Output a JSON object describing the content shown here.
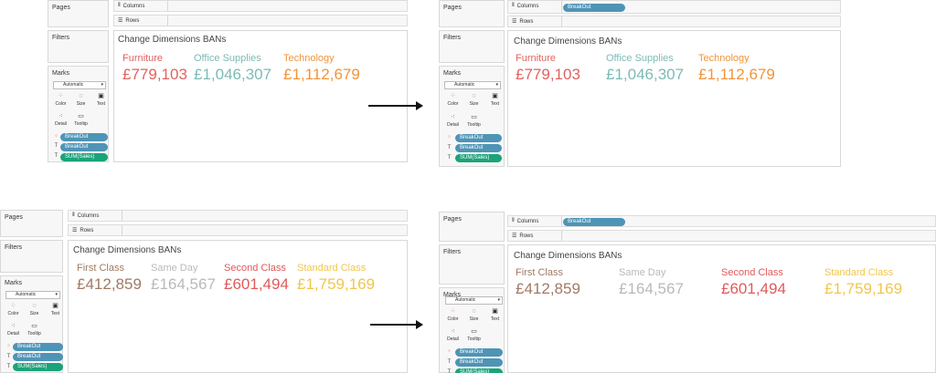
{
  "colors": {
    "furniture": "#e0625f",
    "office": "#7bbbb7",
    "technology": "#f0943a",
    "first_class": "#a07a64",
    "same_day": "#b9b9b9",
    "second_class": "#e05a5a",
    "standard_class": "#f0c64c",
    "pill_blue": "#4e94b6",
    "pill_green": "#1aa37a"
  },
  "shelves": {
    "pages": "Pages",
    "filters": "Filters",
    "marks": "Marks",
    "columns": "Columns",
    "rows": "Rows",
    "mark_type": "Automatic",
    "buttons": {
      "color": "Color",
      "size": "Size",
      "text": "Text",
      "detail": "Detail",
      "tooltip": "Tooltip"
    },
    "mark_pills": [
      "BreakOut",
      "BreakOut",
      "SUM(Sales)"
    ],
    "columns_pill": "BreakOut"
  },
  "view_title": "Change Dimensions BANs",
  "top": {
    "items": [
      {
        "label": "Furniture",
        "value": "£779,103"
      },
      {
        "label": "Office Supplies",
        "value": "£1,046,307"
      },
      {
        "label": "Technology",
        "value": "£1,112,679"
      }
    ]
  },
  "bottom": {
    "items": [
      {
        "label": "First Class",
        "value": "£412,859"
      },
      {
        "label": "Same Day",
        "value": "£164,567"
      },
      {
        "label": "Second Class",
        "value": "£601,494"
      },
      {
        "label": "Standard Class",
        "value": "£1,759,169"
      }
    ]
  }
}
